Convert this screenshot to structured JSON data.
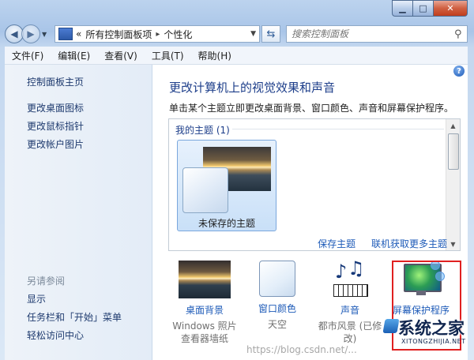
{
  "address": {
    "prefix": "«",
    "crumbs": [
      "所有控制面板项",
      "个性化"
    ],
    "separator": "▸"
  },
  "search": {
    "placeholder": "搜索控制面板"
  },
  "menu": [
    "文件(F)",
    "编辑(E)",
    "查看(V)",
    "工具(T)",
    "帮助(H)"
  ],
  "sidebar": {
    "links": [
      "控制面板主页",
      "更改桌面图标",
      "更改鼠标指针",
      "更改帐户图片"
    ],
    "see_also_header": "另请参阅",
    "see_also": [
      "显示",
      "任务栏和「开始」菜单",
      "轻松访问中心"
    ]
  },
  "main": {
    "title": "更改计算机上的视觉效果和声音",
    "subtitle": "单击某个主题立即更改桌面背景、窗口颜色、声音和屏幕保护程序。",
    "my_themes_header": "我的主题 (1)",
    "unsaved_theme_label": "未保存的主题",
    "save_theme_link": "保存主题",
    "get_more_link": "联机获取更多主题"
  },
  "tiles": [
    {
      "title": "桌面背景",
      "subtitle": "Windows 照片查看器墙纸"
    },
    {
      "title": "窗口颜色",
      "subtitle": "天空"
    },
    {
      "title": "声音",
      "subtitle": "都市风景 (已修改)"
    },
    {
      "title": "屏幕保护程序",
      "subtitle": ""
    }
  ],
  "watermark": {
    "url": "https://blog.csdn.net/...",
    "logo_text": "系统之家",
    "logo_sub": "XITONGZHIJIA.NET"
  },
  "colors": {
    "link": "#1e5bb8",
    "title": "#1d3e8a",
    "highlight_box": "#e02020"
  }
}
